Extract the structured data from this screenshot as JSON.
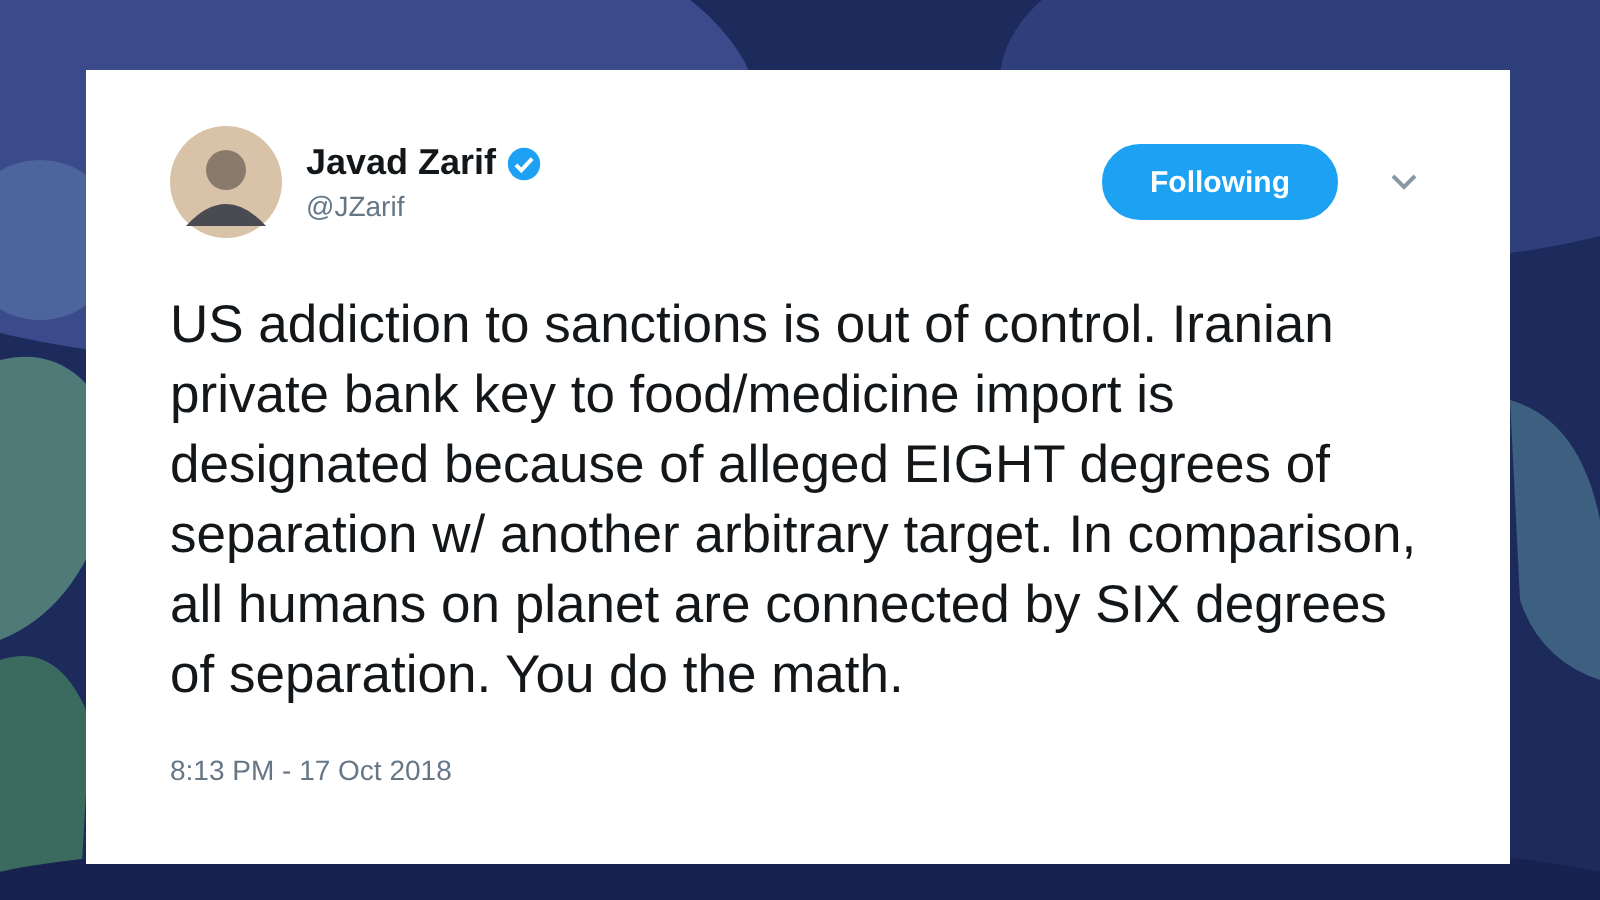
{
  "tweet": {
    "author": {
      "name": "Javad Zarif",
      "handle": "@JZarif",
      "verified": true
    },
    "follow_button": {
      "label": "Following",
      "selected": true
    },
    "text": "US addiction to sanctions is out of control. Iranian private bank key to food/medicine import is designated because of alleged EIGHT degrees of separation w/ another arbitrary target. In comparison, all humans on planet are connected by SIX degrees of separation. You do the math.",
    "timestamp": "8:13 PM - 17 Oct 2018"
  }
}
